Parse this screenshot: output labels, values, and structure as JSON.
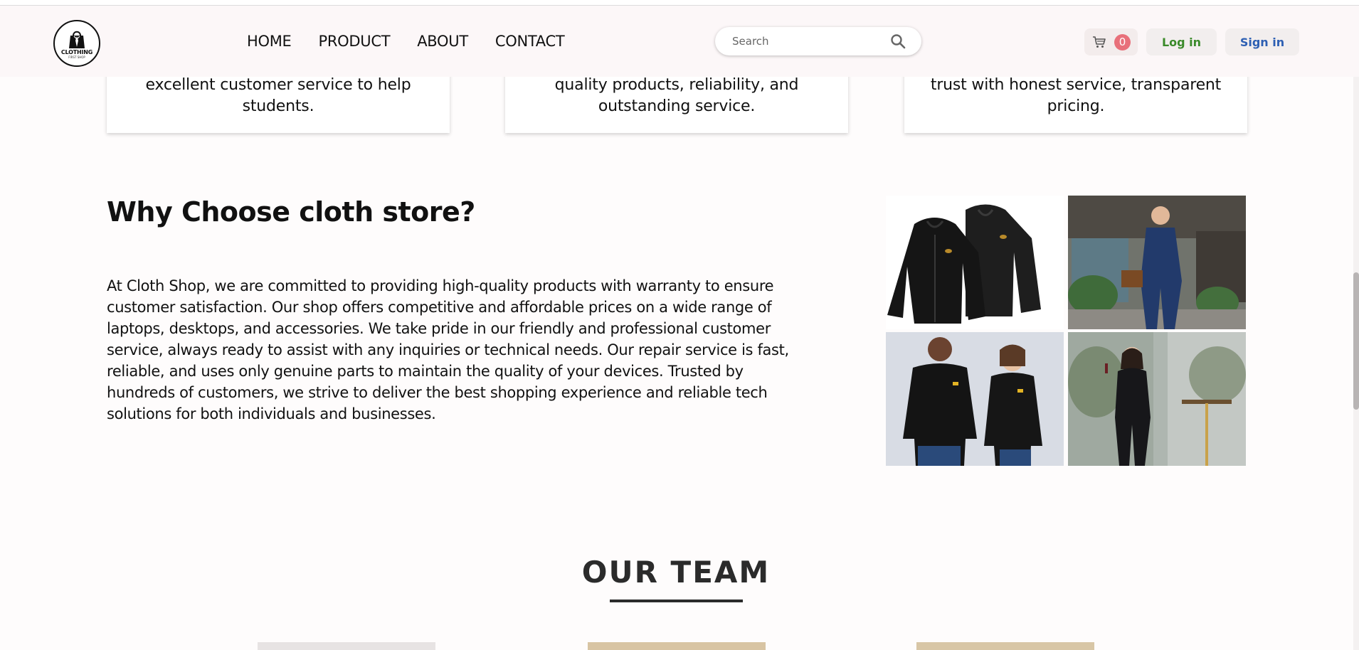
{
  "brand": {
    "logo_text": "CLOTHING",
    "logo_sub": "FIRST SHOP"
  },
  "nav": {
    "items": [
      "HOME",
      "PRODUCT",
      "ABOUT",
      "CONTACT"
    ]
  },
  "search": {
    "placeholder": "Search",
    "icon": "search-icon"
  },
  "cart": {
    "icon": "cart-icon",
    "count": "0",
    "badge_color": "#e8707a"
  },
  "auth": {
    "login_label": "Log in",
    "signin_label": "Sign in",
    "login_color": "#3a8a2a",
    "signin_color": "#2d5fb3"
  },
  "features": [
    {
      "text": "excellent customer service to help students."
    },
    {
      "text": "quality products, reliability, and outstanding service."
    },
    {
      "text": "trust with honest service, transparent pricing."
    }
  ],
  "why": {
    "title": "Why Choose cloth store?",
    "body": "At Cloth Shop, we are committed to providing high-quality products with warranty to ensure customer satisfaction. Our shop offers competitive and affordable prices on a wide range of laptops, desktops, and accessories. We take pride in our friendly and professional customer service, always ready to assist with any inquiries or technical needs. Our repair service is fast, reliable, and uses only genuine parts to maintain the quality of your devices. Trusted by hundreds of customers, we strive to deliver the best shopping experience and reliable tech solutions for both individuals and businesses.",
    "images": [
      "black-jackets-photo",
      "man-in-blue-suit-photo",
      "couple-in-jackets-photo",
      "woman-in-black-suit-photo"
    ]
  },
  "team": {
    "title": "OUR TEAM"
  }
}
